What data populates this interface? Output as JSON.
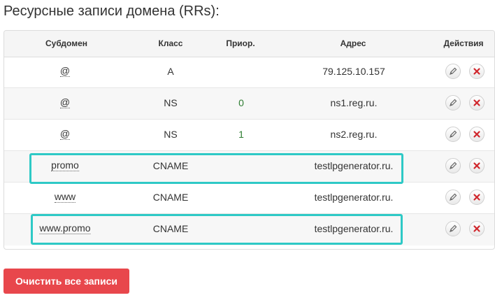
{
  "page": {
    "title": "Ресурсные записи домена (RRs):"
  },
  "table": {
    "headers": {
      "subdomain": "Субдомен",
      "class": "Класс",
      "priority": "Приор.",
      "address": "Адрес",
      "actions": "Действия"
    },
    "rows": [
      {
        "subdomain": "@",
        "class": "A",
        "priority": "",
        "address": "79.125.10.157",
        "highlighted": false
      },
      {
        "subdomain": "@",
        "class": "NS",
        "priority": "0",
        "address": "ns1.reg.ru.",
        "highlighted": false
      },
      {
        "subdomain": "@",
        "class": "NS",
        "priority": "1",
        "address": "ns2.reg.ru.",
        "highlighted": false
      },
      {
        "subdomain": "promo",
        "class": "CNAME",
        "priority": "",
        "address": "testlpgenerator.ru.",
        "highlighted": true
      },
      {
        "subdomain": "www",
        "class": "CNAME",
        "priority": "",
        "address": "testlpgenerator.ru.",
        "highlighted": false
      },
      {
        "subdomain": "www.promo",
        "class": "CNAME",
        "priority": "",
        "address": "testlpgenerator.ru.",
        "highlighted": true
      }
    ],
    "row_actions": [
      "pencil-icon",
      "delete-x-icon"
    ]
  },
  "actions": {
    "clear_all_label": "Очистить все записи"
  },
  "colors": {
    "highlight": "#2ec9c6",
    "danger": "#e8474c",
    "delete_icon": "#d0262c",
    "priority_text": "#2e7d32"
  }
}
